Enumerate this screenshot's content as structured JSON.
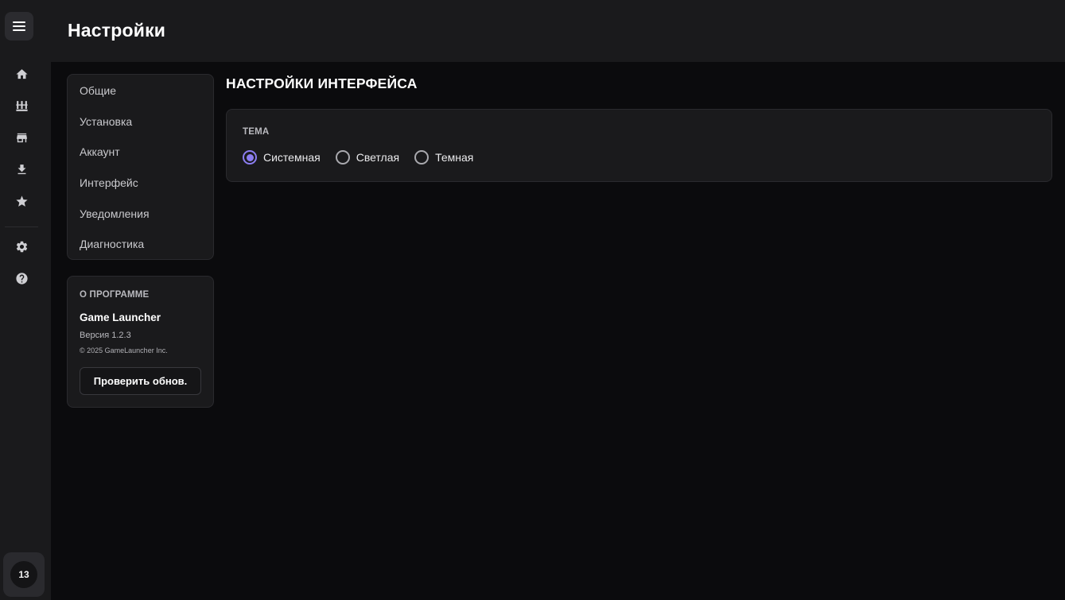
{
  "header": {
    "title": "Настройки"
  },
  "rail": {
    "items": [
      {
        "icon": "home-icon"
      },
      {
        "icon": "library-icon"
      },
      {
        "icon": "store-icon"
      },
      {
        "icon": "download-icon"
      },
      {
        "icon": "star-icon"
      },
      {
        "icon": "gear-icon"
      },
      {
        "icon": "help-icon"
      }
    ],
    "avatar_label": "13"
  },
  "settings_nav": {
    "items": [
      {
        "label": "Общие"
      },
      {
        "label": "Установка"
      },
      {
        "label": "Аккаунт"
      },
      {
        "label": "Интерфейс"
      },
      {
        "label": "Уведомления"
      },
      {
        "label": "Диагностика"
      }
    ]
  },
  "about": {
    "heading": "О ПРОГРАММЕ",
    "app_name": "Game Launcher",
    "version": "Версия 1.2.3",
    "copyright": "© 2025 GameLauncher Inc.",
    "check_button": "Проверить обнов."
  },
  "main": {
    "section_title": "НАСТРОЙКИ ИНТЕРФЕЙСА",
    "theme": {
      "label": "ТЕМА",
      "options": [
        {
          "label": "Системная",
          "selected": true
        },
        {
          "label": "Светлая",
          "selected": false
        },
        {
          "label": "Темная",
          "selected": false
        }
      ]
    }
  },
  "colors": {
    "accent": "#8b7df0",
    "background": "#0b0b0d",
    "panel": "#1a1a1c"
  }
}
